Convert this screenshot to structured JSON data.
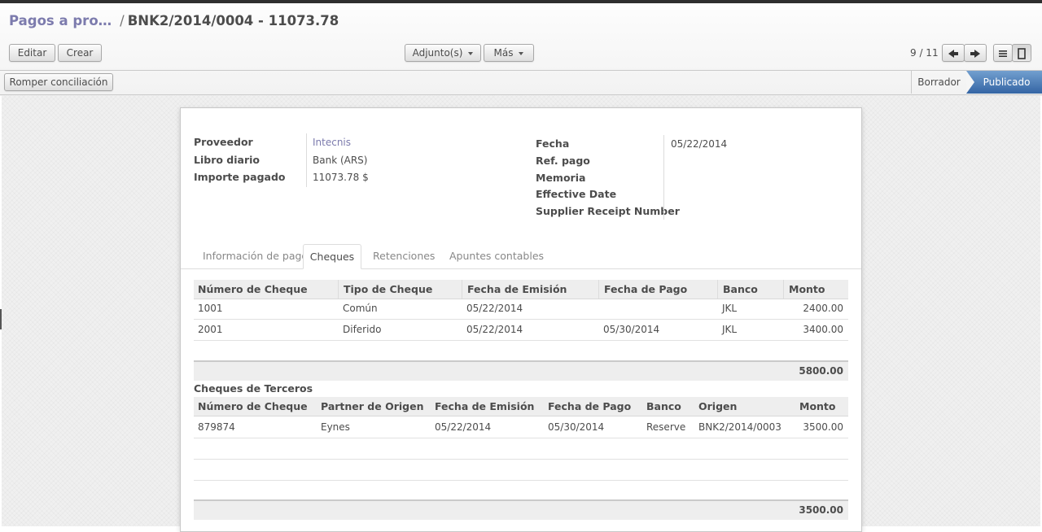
{
  "breadcrumb": {
    "parent": "Pagos a pro…",
    "separator": "/",
    "current": "BNK2/2014/0004 - 11073.78"
  },
  "toolbar": {
    "edit_label": "Editar",
    "create_label": "Crear",
    "attachments_label": "Adjunto(s)",
    "more_label": "Más",
    "pager_value": "9 / 11",
    "break_reconcile_label": "Romper conciliación"
  },
  "statusbar": {
    "draft": "Borrador",
    "posted": "Publicado",
    "active_color": "#3465a4"
  },
  "form": {
    "left": [
      {
        "label": "Proveedor",
        "value": "Intecnis"
      },
      {
        "label": "Libro diario",
        "value": "Bank (ARS)"
      },
      {
        "label": "Importe pagado",
        "value": "11073.78 $"
      }
    ],
    "right": [
      {
        "label": "Fecha",
        "value": "05/22/2014"
      },
      {
        "label": "Ref. pago",
        "value": ""
      },
      {
        "label": "Memoria",
        "value": ""
      },
      {
        "label": "Effective Date",
        "value": ""
      },
      {
        "label": "Supplier Receipt Number",
        "value": ""
      }
    ]
  },
  "tabs": [
    "Información de pago",
    "Cheques",
    "Retenciones",
    "Apuntes contables"
  ],
  "active_tab": "Cheques",
  "checks": {
    "columns": [
      "Número de Cheque",
      "Tipo de Cheque",
      "Fecha de Emisión",
      "Fecha de Pago",
      "Banco",
      "Monto"
    ],
    "rows": [
      [
        "1001",
        "Común",
        "05/22/2014",
        "",
        "JKL",
        "2400.00"
      ],
      [
        "2001",
        "Diferido",
        "05/22/2014",
        "05/30/2014",
        "JKL",
        "3400.00"
      ]
    ],
    "total": "5800.00"
  },
  "third_party_checks": {
    "title": "Cheques de Terceros",
    "columns": [
      "Número de Cheque",
      "Partner de Origen",
      "Fecha de Emisión",
      "Fecha de Pago",
      "Banco",
      "Origen",
      "Monto"
    ],
    "rows": [
      [
        "879874",
        "Eynes",
        "05/22/2014",
        "05/30/2014",
        "Reserve",
        "BNK2/2014/0003",
        "3500.00"
      ]
    ],
    "total": "3500.00"
  }
}
